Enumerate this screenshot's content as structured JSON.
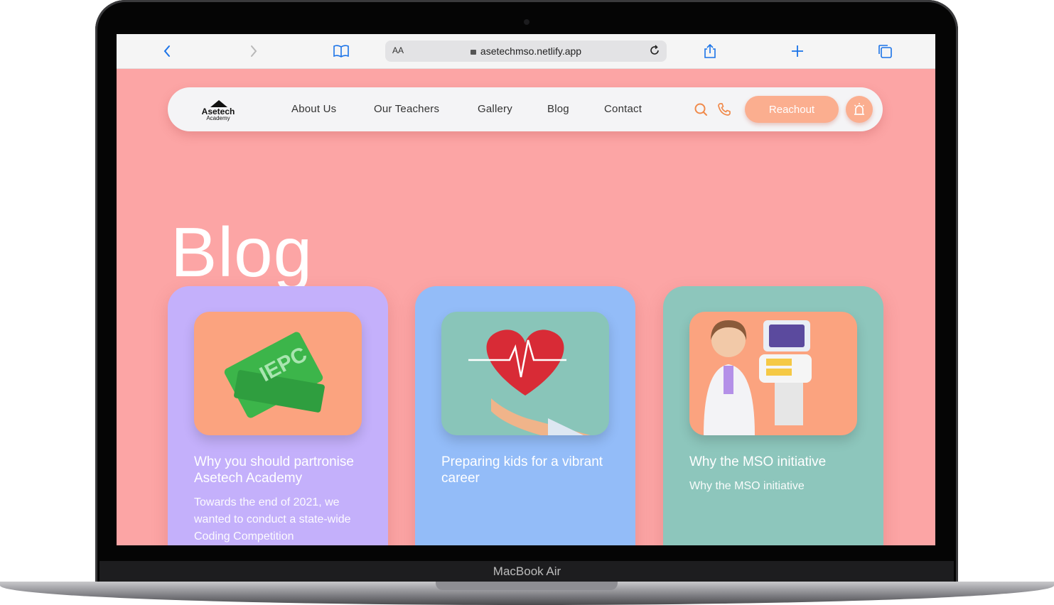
{
  "device": {
    "label": "MacBook Air"
  },
  "browser": {
    "aa_label": "AA",
    "url": "asetechmso.netlify.app",
    "icons": [
      "back-icon",
      "forward-icon",
      "bookmarks-icon",
      "reload-icon",
      "share-icon",
      "new-tab-icon",
      "tabs-icon"
    ]
  },
  "navbar": {
    "logo_text": "Asetech Academy",
    "links": [
      "About Us",
      "Our Teachers",
      "Gallery",
      "Blog",
      "Contact"
    ],
    "cta_label": "Reachout",
    "icons": [
      "search-icon",
      "phone-icon",
      "alarm-icon"
    ]
  },
  "page": {
    "title": "Blog"
  },
  "cards": [
    {
      "title": "Why you should partronise Asetech Academy",
      "description": "Towards the end of 2021, we wanted to conduct a state-wide Coding Competition",
      "bg_color": "#c4b0fb",
      "image_bg": "#fba37f"
    },
    {
      "title": "Preparing kids for a vibrant career",
      "description": "",
      "bg_color": "#93bcf8",
      "image_bg": "#89c5b9"
    },
    {
      "title": "Why the MSO initiative",
      "description": "Why the MSO initiative",
      "bg_color": "#8dc6bc",
      "image_bg": "#fba37f"
    }
  ],
  "colors": {
    "page_bg": "#fca5a5",
    "accent": "#fbae8f",
    "icon_orange": "#f08a4b",
    "safari_blue": "#1a73e8"
  }
}
